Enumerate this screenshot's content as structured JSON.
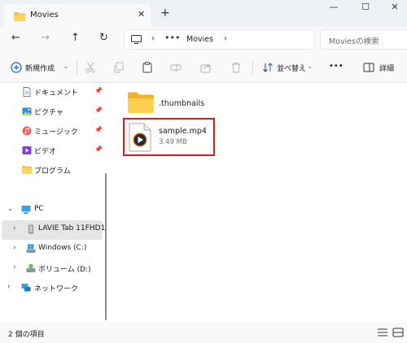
{
  "tab": {
    "title": "Movies",
    "close_icon": "close-icon",
    "new_tab_symbol": "+"
  },
  "window_controls": {
    "minimize": "—",
    "maximize": "☐",
    "close": "✕"
  },
  "nav": {
    "back": "←",
    "forward": "→",
    "up": "↑",
    "refresh": "↻",
    "address": {
      "separator": "›",
      "overflow": "•••",
      "location": "Movies"
    },
    "search": {
      "placeholder": "Moviesの検索"
    }
  },
  "toolbar": {
    "new_label": "新規作成",
    "sort_label": "並べ替え",
    "more_label": "•••",
    "details_label": "詳細"
  },
  "sidebar": {
    "quick_access": [
      {
        "label": "ドキュメント",
        "icon": "document-icon",
        "pinned": true
      },
      {
        "label": "ピクチャ",
        "icon": "pictures-icon",
        "pinned": true
      },
      {
        "label": "ミュージック",
        "icon": "music-icon",
        "pinned": true
      },
      {
        "label": "ビデオ",
        "icon": "video-icon",
        "pinned": true
      },
      {
        "label": "プログラム",
        "icon": "folder-icon",
        "pinned": false
      }
    ],
    "pc": {
      "label": "PC",
      "icon": "pc-icon"
    },
    "drives": [
      {
        "label": "LAVIE Tab 11FHD1",
        "icon": "tablet-icon",
        "selected": true
      },
      {
        "label": "Windows (C:)",
        "icon": "windows-drive-icon",
        "selected": false
      },
      {
        "label": "ボリューム (D:)",
        "icon": "drive-icon",
        "selected": false
      }
    ],
    "network": {
      "label": "ネットワーク",
      "icon": "network-icon"
    }
  },
  "content": {
    "items": [
      {
        "name": ".thumbnails",
        "type": "folder",
        "icon": "folder-icon"
      },
      {
        "name": "sample.mp4",
        "size": "3.49 MB",
        "type": "video",
        "icon": "video-file-icon",
        "highlighted": true
      }
    ]
  },
  "status": {
    "item_count": "2 個の項目"
  },
  "colors": {
    "highlight_border": "#e8141c",
    "folder_yellow": "#f4c244",
    "accent_blue": "#0a64c8"
  }
}
